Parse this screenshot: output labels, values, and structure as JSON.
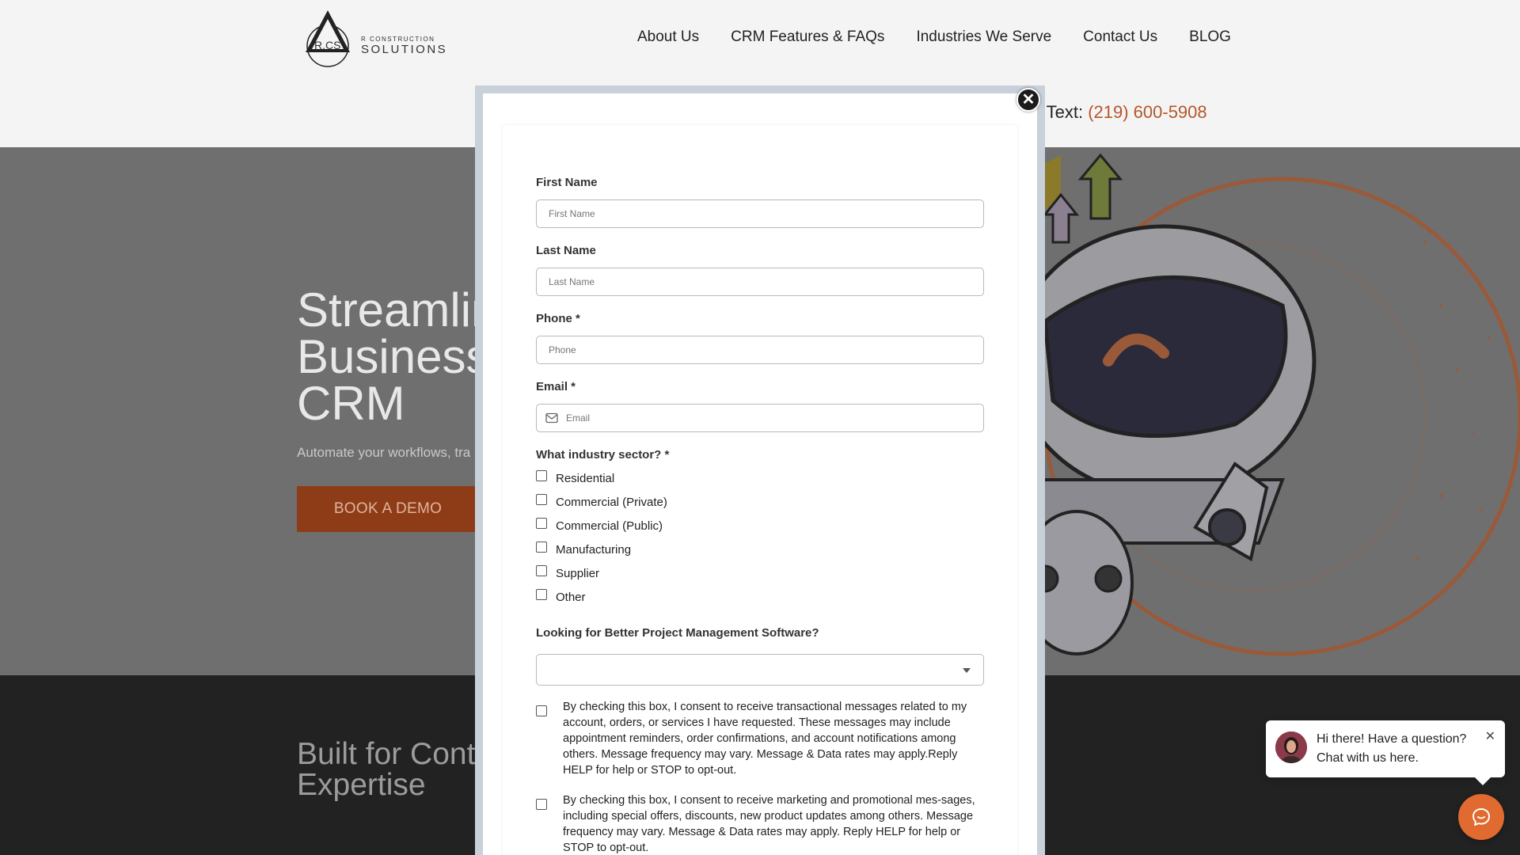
{
  "header": {
    "logo_text_small": "R CONSTRUCTION",
    "logo_text_big": "SOLUTIONS",
    "logo_monogram": "R.CS",
    "nav": [
      "About Us",
      "CRM Features & FAQs",
      "Industries We Serve",
      "Contact Us",
      "BLOG"
    ],
    "call_label": "ll/ Text: ",
    "call_phone": "(219) 600-5908"
  },
  "hero": {
    "title_lines": [
      "Streamlin",
      "Business",
      "CRM"
    ],
    "subtitle": "Automate your workflows, tra",
    "cta": "BOOK A DEMO"
  },
  "section2": {
    "title_lines": [
      "Built for Contr",
      "Expertise"
    ]
  },
  "modal": {
    "close_symbol": "✕",
    "fields": {
      "first_name": {
        "label": "First Name",
        "placeholder": "First Name"
      },
      "last_name": {
        "label": "Last Name",
        "placeholder": "Last Name"
      },
      "phone": {
        "label": "Phone *",
        "placeholder": "Phone"
      },
      "email": {
        "label": "Email *",
        "placeholder": "Email"
      }
    },
    "industry_label": "What industry sector? *",
    "industries": [
      "Residential",
      "Commercial (Private)",
      "Commercial (Public)",
      "Manufacturing",
      "Supplier",
      "Other"
    ],
    "pm_label": "Looking for Better Project Management Software?",
    "pm_value": "",
    "consent_transactional": "By checking this box, I consent to receive transactional messages related to my account, orders, or services I have requested. These messages may include appointment reminders, order confirmations, and account notifications among others. Message frequency may vary. Message & Data rates may apply.Reply HELP for help or STOP to opt-out.",
    "consent_marketing": "By checking this box, I consent to receive marketing and promotional mes-sages, including special offers, discounts, new product updates among others. Message frequency may vary. Message & Data rates may apply. Reply HELP for help or STOP to opt-out."
  },
  "chat": {
    "greeting_line1": "Hi there! Have a question?",
    "greeting_line2": "Chat with us here.",
    "close_symbol": "✕"
  },
  "colors": {
    "accent": "#e06a2f",
    "phone": "#b5572a",
    "cta_bg": "#8e3c17"
  }
}
